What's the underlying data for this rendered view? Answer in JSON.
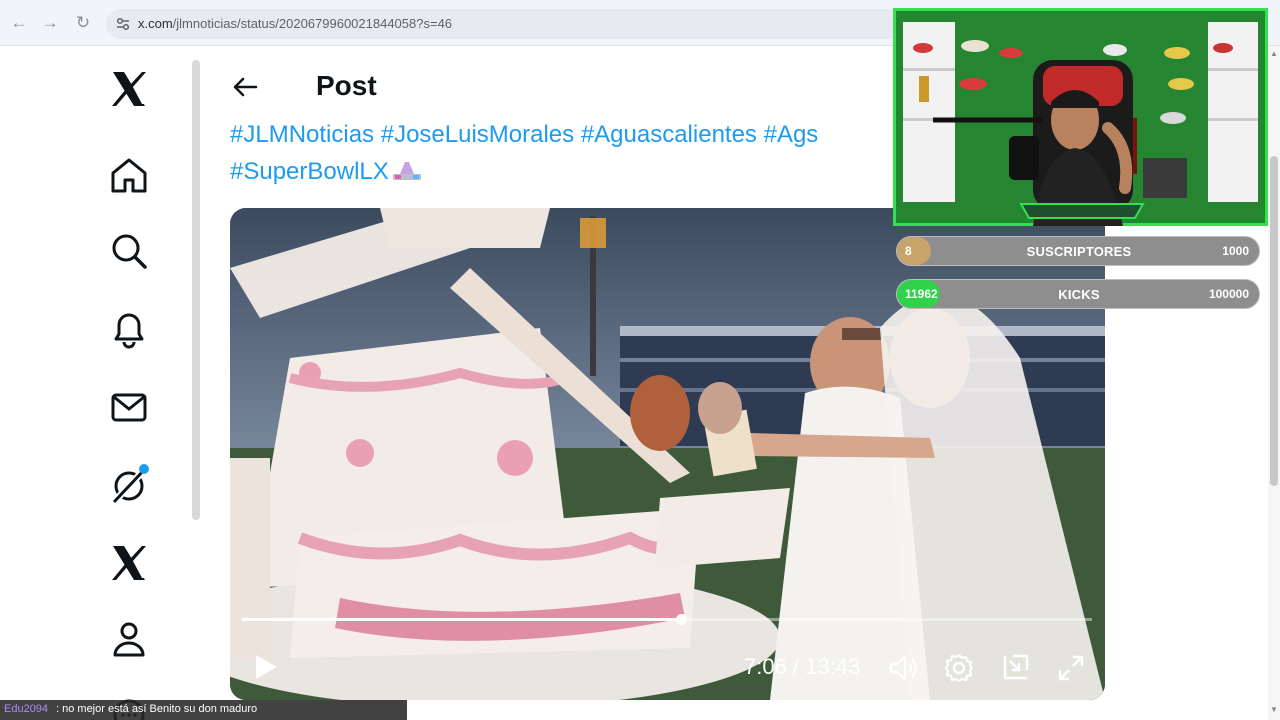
{
  "browser": {
    "url_host": "x.com",
    "url_path": "/jlmnoticias/status/2020679960021844058?s=46",
    "back_icon": "arrow-left-icon",
    "forward_icon": "arrow-right-icon",
    "reload_icon": "reload-icon"
  },
  "sidebar": {
    "items": [
      {
        "name": "x-logo-icon"
      },
      {
        "name": "home-icon"
      },
      {
        "name": "search-icon"
      },
      {
        "name": "notifications-bell-icon"
      },
      {
        "name": "messages-envelope-icon"
      },
      {
        "name": "grok-icon"
      },
      {
        "name": "x-premium-icon"
      },
      {
        "name": "profile-icon"
      },
      {
        "name": "more-icon"
      }
    ]
  },
  "post": {
    "title": "Post",
    "hashtag_line1": "#JLMNoticias #JoseLuisMorales #Aguascalientes #Ags",
    "hashtag_line2": "#SuperBowlLX"
  },
  "video": {
    "time": "7:06 / 13:43",
    "progress_fraction": 0.517,
    "play_icon": "play-icon",
    "volume_icon": "volume-icon",
    "settings_icon": "gear-icon",
    "pip_icon": "picture-in-picture-icon",
    "fullscreen_icon": "fullscreen-icon"
  },
  "goals": [
    {
      "current": "8",
      "label": "SUSCRIPTORES",
      "target": "1000",
      "fill_fraction": 0.008,
      "fill_color": "#c9a46a"
    },
    {
      "current": "11962",
      "label": "KICKS",
      "target": "100000",
      "fill_fraction": 0.12,
      "fill_color": "#2fd24a"
    }
  ],
  "chat": {
    "user": "Edu2094",
    "message": ": no mejor está así Benito su don maduro"
  },
  "colors": {
    "accent": "#1d9bf0",
    "webcam_border": "#34e04f"
  }
}
